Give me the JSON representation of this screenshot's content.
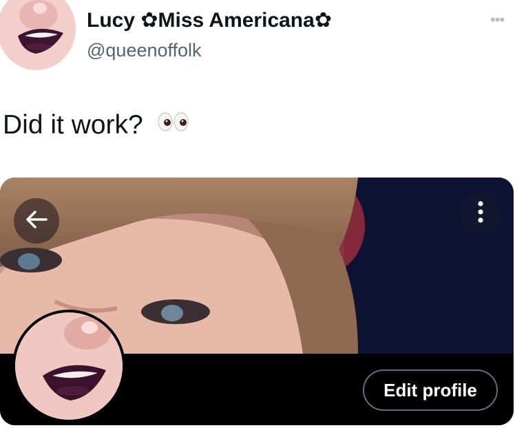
{
  "tweet": {
    "display_name": "Lucy ✿Miss Americana✿",
    "handle": "@queenoffolk",
    "more_icon": "ellipsis-icon",
    "text": "Did it work?",
    "emoji": "eyes-emoji"
  },
  "profile_preview": {
    "back_icon": "arrow-left-icon",
    "menu_icon": "vertical-ellipsis-icon",
    "edit_button_label": "Edit profile"
  },
  "colors": {
    "text_primary": "#0f1419",
    "text_secondary": "#536471",
    "button_border": "#5b7083",
    "header_dark": "#0b1030"
  }
}
